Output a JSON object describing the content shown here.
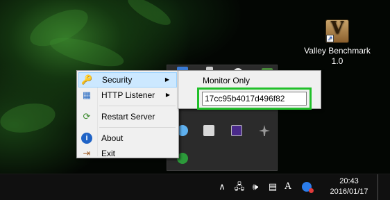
{
  "desktop": {
    "shortcut_label_line1": "Valley Benchmark",
    "shortcut_label_line2": "1.0",
    "shortcut_glyph": "V"
  },
  "context_menu": {
    "items": [
      {
        "label": "Security",
        "icon": "key-icon",
        "has_submenu": true,
        "active": true
      },
      {
        "label": "HTTP Listener",
        "icon": "network-icon",
        "has_submenu": true
      },
      {
        "label": "Restart Server",
        "icon": "restart-icon",
        "has_submenu": false
      },
      {
        "label": "About",
        "icon": "info-icon",
        "has_submenu": false
      },
      {
        "label": "Exit",
        "icon": "exit-icon",
        "has_submenu": false
      }
    ],
    "arrow_glyph": "▶"
  },
  "submenu": {
    "mode_label": "Monitor Only",
    "token_value": "17cc95b4017d496f82"
  },
  "taskbar": {
    "time": "20:43",
    "date": "2016/01/17",
    "ime_label": "A",
    "chevron": "∧"
  },
  "colors": {
    "highlight": "#21c02a",
    "menu_active_bg": "#cce8ff",
    "taskbar_bg": "#101010"
  }
}
